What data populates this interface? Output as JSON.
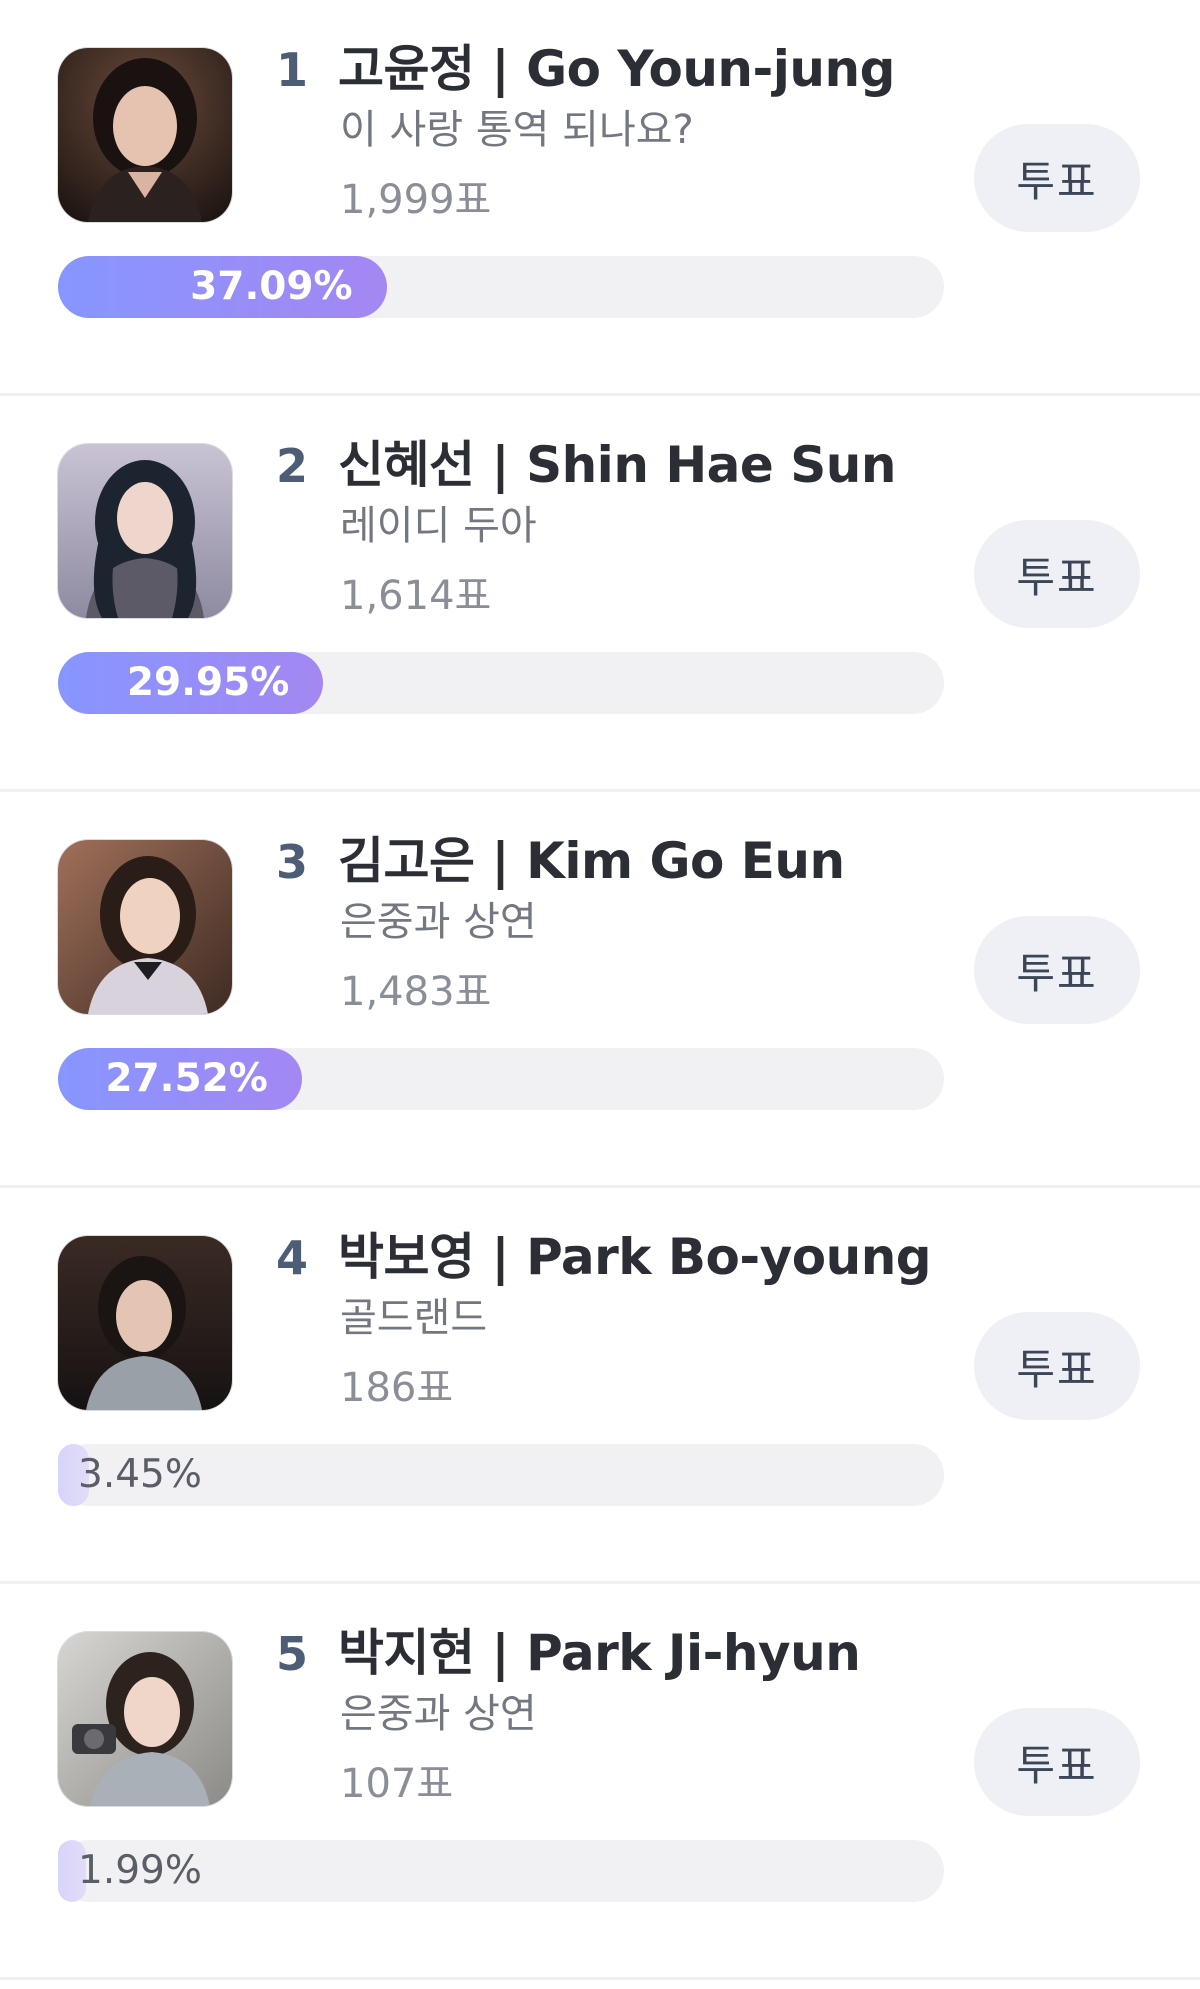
{
  "entries": [
    {
      "rank": "1",
      "name": "고윤정 | Go Youn-jung",
      "show": "이 사랑 통역 되나요?",
      "votes": "1,999표",
      "percent_label": "37.09%",
      "percent": 37.09,
      "vote_label": "투표"
    },
    {
      "rank": "2",
      "name": "신혜선 | Shin Hae Sun",
      "show": "레이디 두아",
      "votes": "1,614표",
      "percent_label": "29.95%",
      "percent": 29.95,
      "vote_label": "투표"
    },
    {
      "rank": "3",
      "name": "김고은 | Kim Go Eun",
      "show": "은중과 상연",
      "votes": "1,483표",
      "percent_label": "27.52%",
      "percent": 27.52,
      "vote_label": "투표"
    },
    {
      "rank": "4",
      "name": "박보영 | Park Bo-young",
      "show": "골드랜드",
      "votes": "186표",
      "percent_label": "3.45%",
      "percent": 3.45,
      "vote_label": "투표"
    },
    {
      "rank": "5",
      "name": "박지현 | Park Ji-hyun",
      "show": "은중과 상연",
      "votes": "107표",
      "percent_label": "1.99%",
      "percent": 1.99,
      "vote_label": "투표"
    }
  ],
  "colors": {
    "bar_start": "#8796ff",
    "bar_end": "#a487f2",
    "track": "#f1f1f3",
    "vote_button_bg": "#eef0f6"
  }
}
